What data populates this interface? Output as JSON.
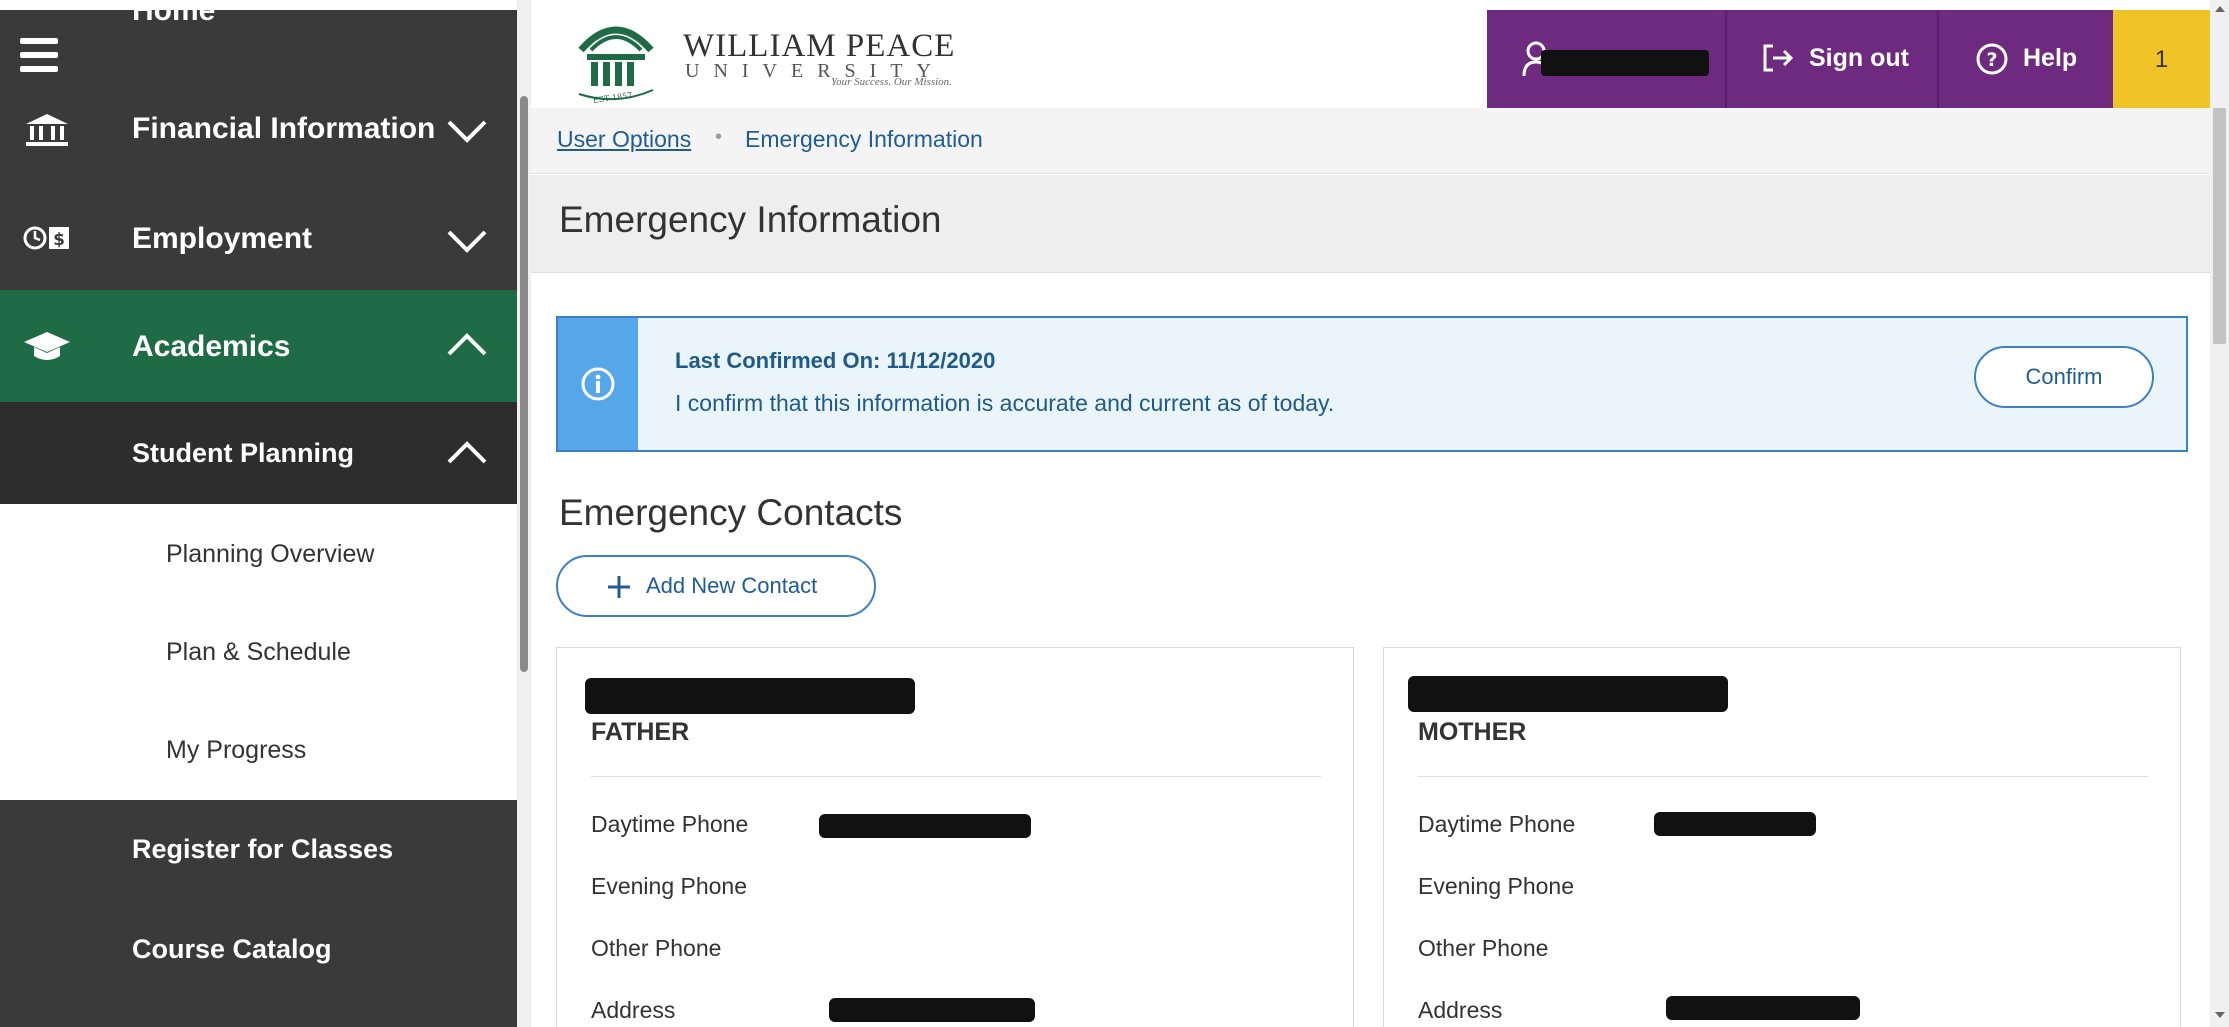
{
  "sidebar": {
    "home_label": "Home",
    "items": [
      {
        "label": "Financial Information",
        "icon": "bank-icon"
      },
      {
        "label": "Employment",
        "icon": "clock-money-icon"
      },
      {
        "label": "Academics",
        "icon": "graduation-cap-icon"
      },
      {
        "label": "Student Planning"
      }
    ],
    "sub_items": [
      "Planning Overview",
      "Plan & Schedule",
      "My Progress"
    ],
    "bottom_items": [
      "Register for Classes",
      "Course Catalog"
    ]
  },
  "header": {
    "logo_name": "WILLIAM PEACE",
    "logo_university": "UNIVERSITY",
    "logo_tagline": "Your Success. Our Mission.",
    "logo_est": "EST 1857",
    "sign_out_label": "Sign out",
    "help_label": "Help",
    "notification_count": "1",
    "accent_color": "#6d2a7e",
    "notif_color": "#f0c426"
  },
  "breadcrumb": {
    "parent": "User Options",
    "separator": "•",
    "current": "Emergency Information"
  },
  "page": {
    "title": "Emergency Information"
  },
  "alert": {
    "title": "Last Confirmed On: 11/12/2020",
    "message": "I confirm that this information is accurate and current as of today.",
    "confirm_label": "Confirm"
  },
  "contacts": {
    "section_title": "Emergency Contacts",
    "add_label": "Add New Contact",
    "field_labels": [
      "Daytime Phone",
      "Evening Phone",
      "Other Phone",
      "Address"
    ],
    "cards": [
      {
        "relationship": "FATHER"
      },
      {
        "relationship": "MOTHER"
      }
    ]
  }
}
